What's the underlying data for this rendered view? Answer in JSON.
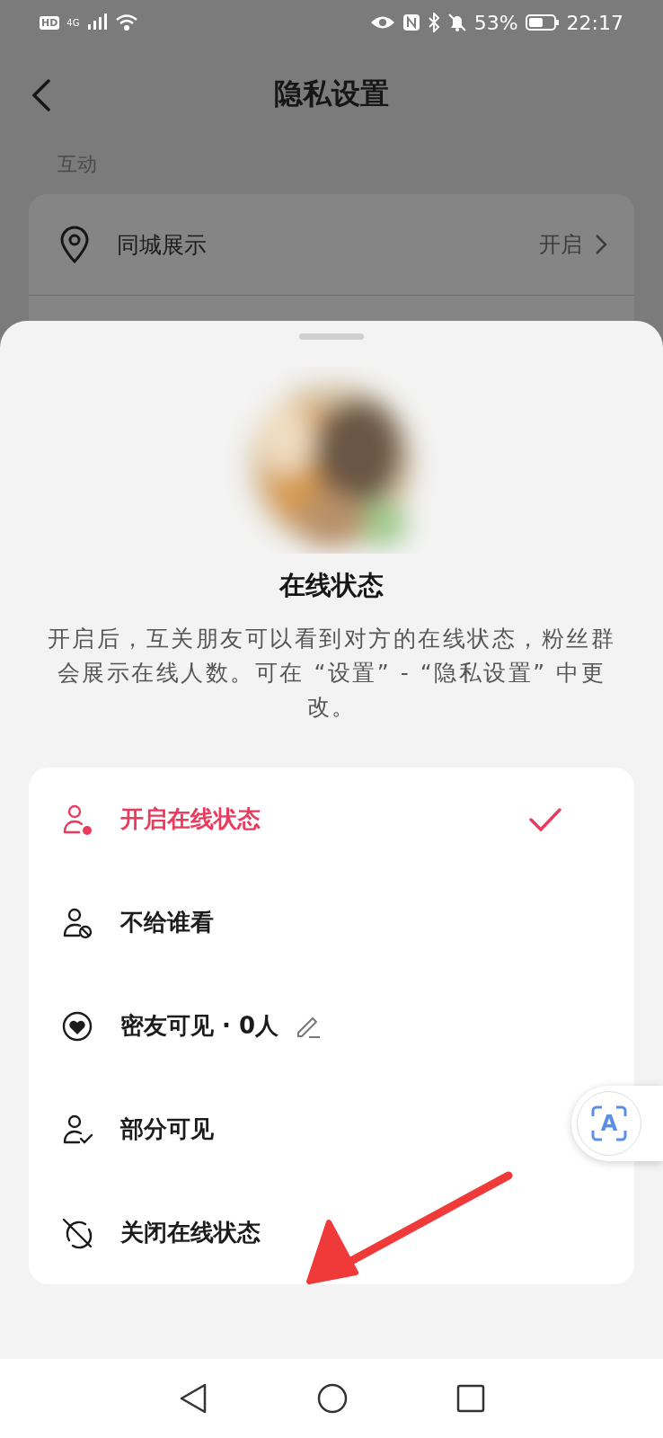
{
  "status_bar": {
    "badges": [
      "HD",
      "4G"
    ],
    "battery": "53%",
    "time": "22:17"
  },
  "header": {
    "title": "隐私设置"
  },
  "section": {
    "heading": "互动",
    "rows": [
      {
        "label": "同城展示",
        "value": "开启"
      }
    ]
  },
  "sheet": {
    "title": "在线状态",
    "description": "开启后，互关朋友可以看到对方的在线状态，粉丝群会展示在线人数。可在 “设置” - “隐私设置” 中更改。",
    "options": [
      {
        "kind": "online",
        "label": "开启在线状态",
        "selected": true
      },
      {
        "kind": "blocked",
        "label": "不给谁看",
        "selected": false
      },
      {
        "kind": "friends",
        "label": "密友可见 · 0人",
        "selected": false,
        "editable": true
      },
      {
        "kind": "partial",
        "label": "部分可见",
        "selected": false
      },
      {
        "kind": "off",
        "label": "关闭在线状态",
        "selected": false
      }
    ]
  },
  "float_button": {
    "label": "A"
  }
}
